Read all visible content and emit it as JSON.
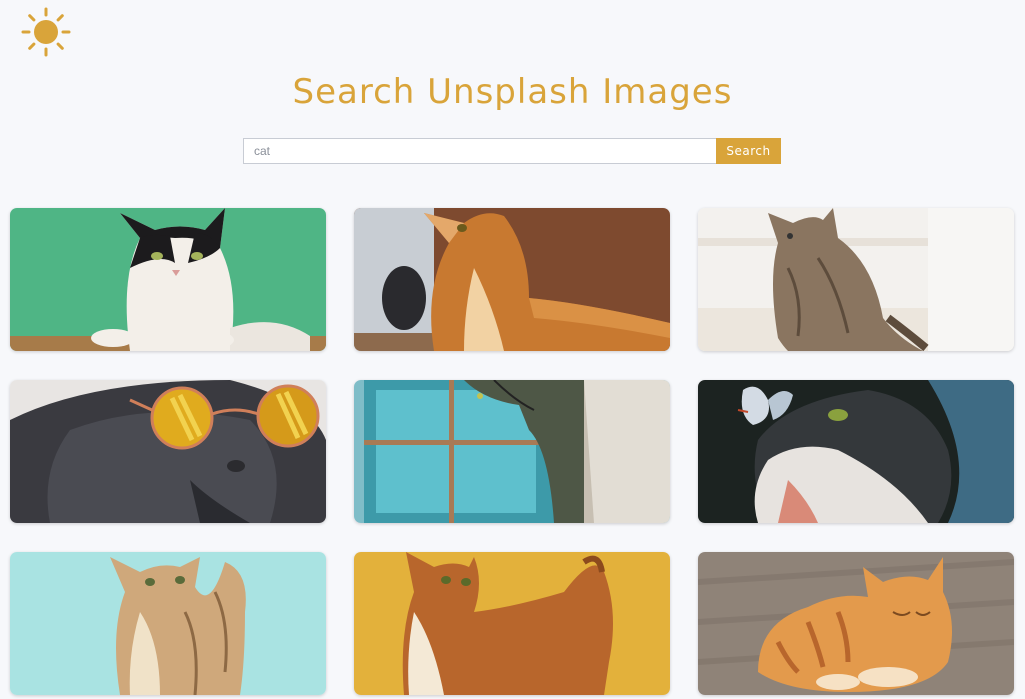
{
  "header": {
    "theme_icon": "sun-icon",
    "title": "Search Unsplash Images"
  },
  "search": {
    "value": "cat",
    "button_label": "Search"
  },
  "accent_color": "#d9a43a",
  "results": [
    {
      "subject": "black-and-white-cat-photo"
    },
    {
      "subject": "orange-tabby-cat-photo"
    },
    {
      "subject": "grey-tabby-cat-on-stairs-photo"
    },
    {
      "subject": "grey-cat-with-sunglasses-photo"
    },
    {
      "subject": "grey-cat-by-window-photo"
    },
    {
      "subject": "fluffy-cat-with-butterfly-photo"
    },
    {
      "subject": "kitten-looking-up-photo"
    },
    {
      "subject": "orange-cat-on-yellow-photo"
    },
    {
      "subject": "orange-tabby-lying-on-floor-photo"
    }
  ]
}
